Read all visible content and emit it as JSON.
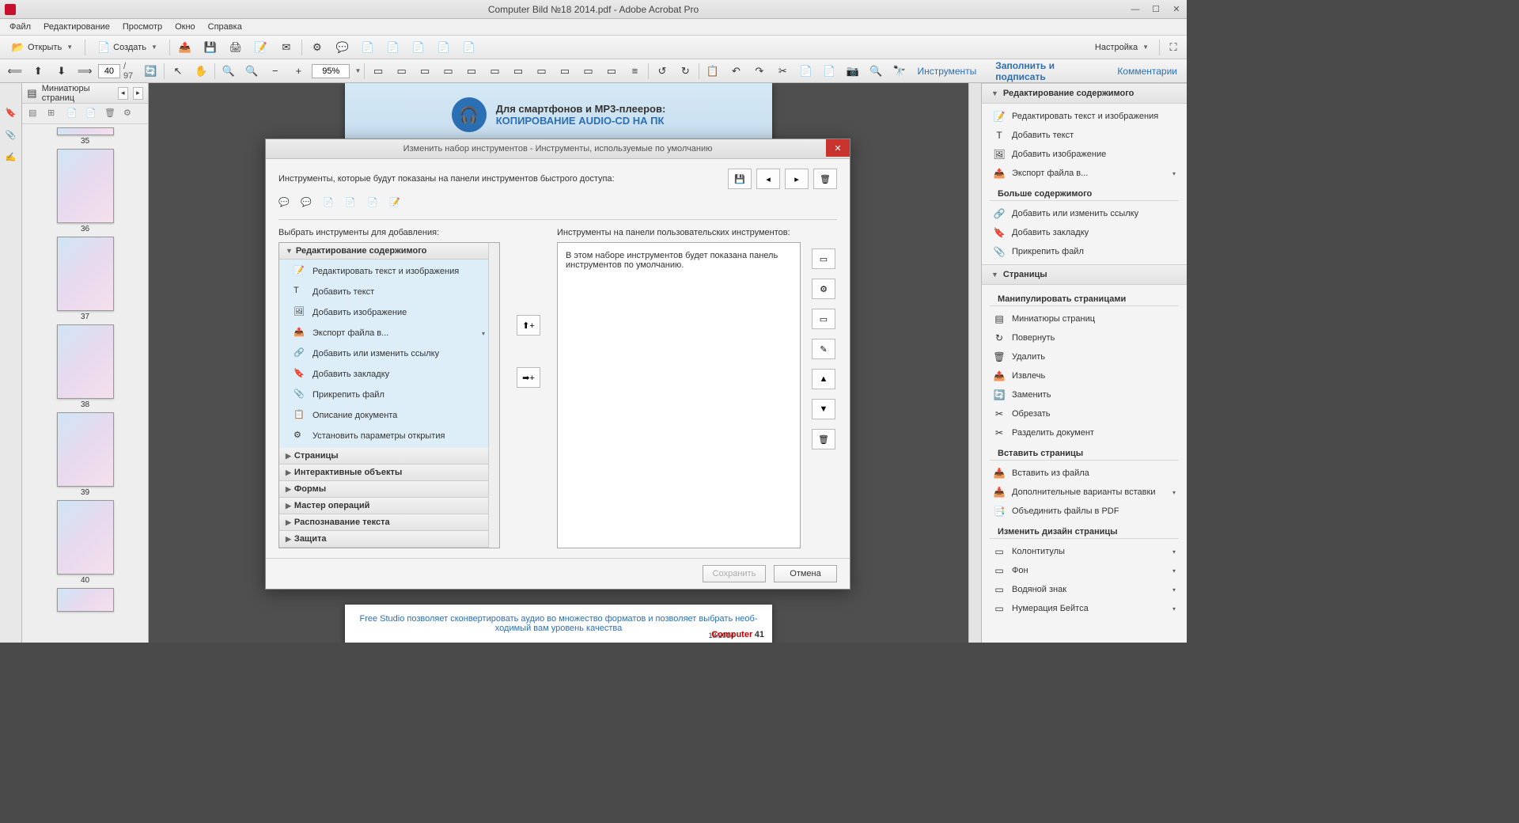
{
  "window": {
    "title": "Computer Bild №18 2014.pdf - Adobe Acrobat Pro"
  },
  "menu": [
    "Файл",
    "Редактирование",
    "Просмотр",
    "Окно",
    "Справка"
  ],
  "toolbar1": {
    "open": "Открыть",
    "create": "Создать",
    "settings": "Настройка"
  },
  "toolbar2": {
    "page_current": "40",
    "page_total": "/ 97",
    "zoom": "95%",
    "right_links": [
      "Инструменты",
      "Заполнить и подписать",
      "Комментарии"
    ]
  },
  "thumbnails": {
    "title": "Миниатюры страниц",
    "pages": [
      "35",
      "36",
      "37",
      "38",
      "39",
      "40"
    ]
  },
  "doc_banner": {
    "line1": "Для смартфонов и MP3-плееров:",
    "line2": "КОПИРОВАНИЕ AUDIO-CD НА ПК"
  },
  "doc_footer": {
    "text": "Free Studio позволяет сконвертировать аудио во множество форматов и позволяет выбрать необ-",
    "text2": "ходимый вам уровень качества",
    "issue": "18/2014",
    "brand": "Computer",
    "pagenum": "41"
  },
  "dialog": {
    "title": "Изменить набор инструментов - Инструменты, используемые по умолчанию",
    "label_shown": "Инструменты, которые будут показаны на панели инструментов быстрого доступа:",
    "label_select": "Выбрать инструменты для добавления:",
    "label_user": "Инструменты на панели пользовательских инструментов:",
    "right_text": "В этом наборе инструментов будет показана панель инструментов по умолчанию.",
    "categories_open": "Редактирование содержимого",
    "open_items": [
      "Редактировать текст и изображения",
      "Добавить текст",
      "Добавить изображение",
      "Экспорт файла в...",
      "Добавить или изменить ссылку",
      "Добавить закладку",
      "Прикрепить файл",
      "Описание документа",
      "Установить параметры открытия"
    ],
    "categories_closed": [
      "Страницы",
      "Интерактивные объекты",
      "Формы",
      "Мастер операций",
      "Распознавание текста",
      "Защита"
    ],
    "save": "Сохранить",
    "cancel": "Отмена"
  },
  "right_panel": {
    "sec1": "Редактирование содержимого",
    "sec1_items": [
      "Редактировать текст и изображения",
      "Добавить текст",
      "Добавить изображение",
      "Экспорт файла в..."
    ],
    "sub1": "Больше содержимого",
    "sub1_items": [
      "Добавить или изменить ссылку",
      "Добавить закладку",
      "Прикрепить файл"
    ],
    "sec2": "Страницы",
    "sub2": "Манипулировать страницами",
    "sub2_items": [
      "Миниатюры страниц",
      "Повернуть",
      "Удалить",
      "Извлечь",
      "Заменить",
      "Обрезать",
      "Разделить документ"
    ],
    "sub3": "Вставить страницы",
    "sub3_items": [
      "Вставить из файла",
      "Дополнительные варианты вставки",
      "Объединить файлы в PDF"
    ],
    "sub4": "Изменить дизайн страницы",
    "sub4_items": [
      "Колонтитулы",
      "Фон",
      "Водяной знак",
      "Нумерация Бейтса"
    ]
  }
}
